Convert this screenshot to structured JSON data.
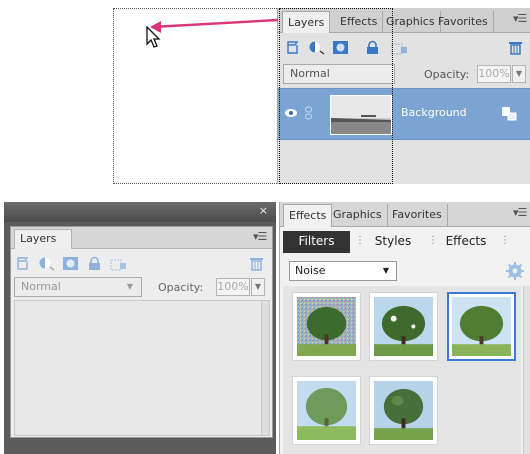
{
  "top_panel": {
    "tabs": [
      "Layers",
      "Effects",
      "Graphics",
      "Favorites"
    ],
    "menu_icon": "panel-menu-icon",
    "blend_mode": "Normal",
    "opacity_label": "Opacity:",
    "opacity_value": "100%",
    "layer_name": "Background"
  },
  "layers_panel": {
    "close_label": "×",
    "tab": "Layers",
    "blend_mode": "Normal",
    "opacity_label": "Opacity:",
    "opacity_value": "100%"
  },
  "effects_panel": {
    "tabs": [
      "Effects",
      "Graphics",
      "Favorites"
    ],
    "segments": [
      "Filters",
      "Styles",
      "Effects"
    ],
    "filter_category": "Noise",
    "thumbnails": [
      {
        "name": "noise-thumb",
        "selected": false
      },
      {
        "name": "dust-thumb",
        "selected": false
      },
      {
        "name": "median-thumb",
        "selected": true
      },
      {
        "name": "blur-thumb",
        "selected": false
      },
      {
        "name": "grain-thumb",
        "selected": false
      }
    ]
  },
  "colors": {
    "accent_arrow": "#d8357a",
    "selection_blue": "#3c7bd0",
    "layer_highlight": "#7ba4d2"
  }
}
